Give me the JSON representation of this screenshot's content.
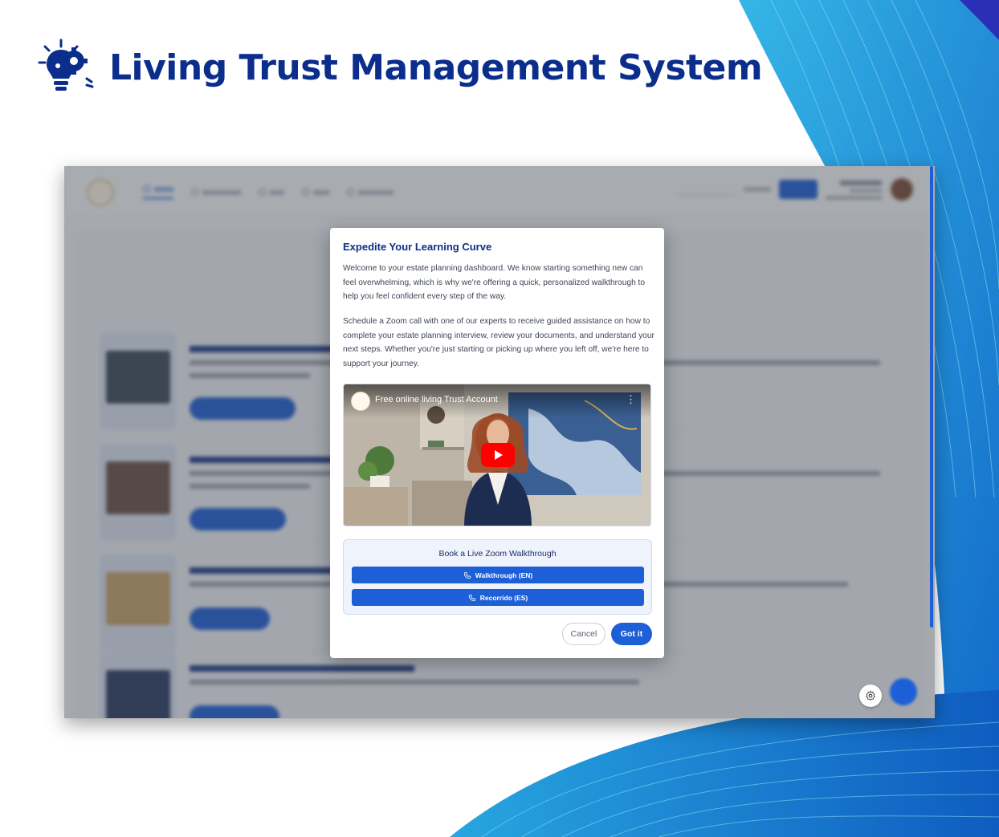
{
  "header": {
    "title": "Living Trust Management System"
  },
  "colors": {
    "brand_navy": "#0b2d8c",
    "primary_blue": "#1d5fd6",
    "modal_title": "#0e2e86"
  },
  "modal": {
    "title": "Expedite Your Learning Curve",
    "paragraph_1": "Welcome to your estate planning dashboard. We know starting something new can feel overwhelming, which is why we're offering a quick, personalized walkthrough to help you feel confident every step of the way.",
    "paragraph_2": "Schedule a Zoom call with one of our experts to receive guided assistance on how to complete your estate planning interview, review your documents, and understand your next steps. Whether you're just starting or picking up where you left off, we're here to support your journey.",
    "video": {
      "title": "Free online living Trust Account",
      "play_icon": "youtube-play-icon",
      "menu_icon": "kebab-menu-icon"
    },
    "booking": {
      "title": "Book a Live Zoom Walkthrough",
      "walkthrough_en_label": "Walkthrough (EN)",
      "walkthrough_es_label": "Recorrido (ES)",
      "button_icon": "phone-icon"
    },
    "cancel_label": "Cancel",
    "confirm_label": "Got it"
  },
  "floating": {
    "settings_icon": "gear-icon"
  }
}
